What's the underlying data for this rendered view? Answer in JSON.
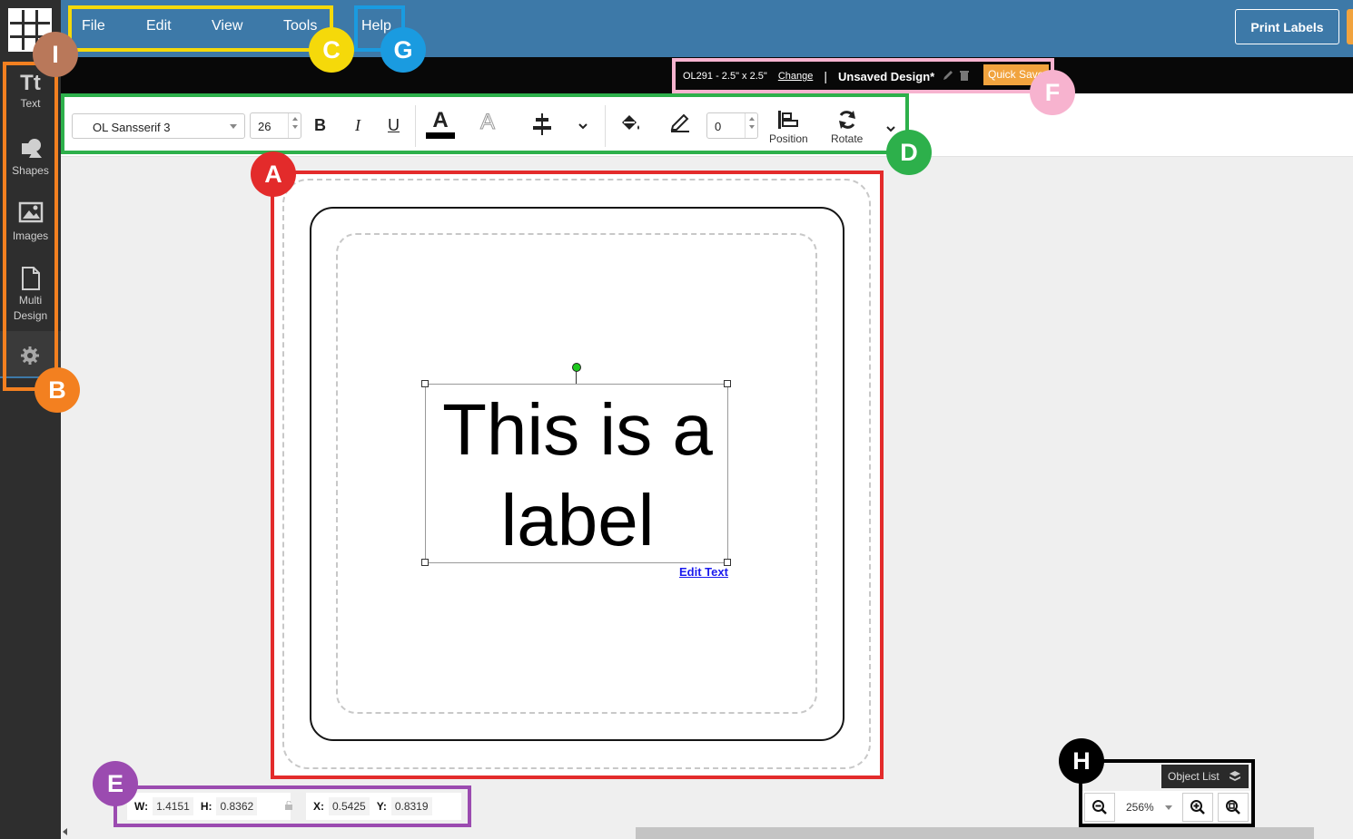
{
  "menu": {
    "file": "File",
    "edit": "Edit",
    "view": "View",
    "tools": "Tools",
    "help": "Help"
  },
  "header": {
    "print_labels": "Print Labels",
    "label_size": "OL291 - 2.5\" x 2.5\"",
    "change_link": "Change",
    "separator": "|",
    "design_name": "Unsaved Design*",
    "quick_save": "Quick Save"
  },
  "sidebar": {
    "items": [
      {
        "label": "Text",
        "icon": "text-icon"
      },
      {
        "label": "Shapes",
        "icon": "shapes-icon"
      },
      {
        "label": "Images",
        "icon": "images-icon"
      },
      {
        "label_line1": "Multi",
        "label_line2": "Design",
        "icon": "multi-design-icon"
      },
      {
        "icon": "gear-icon"
      }
    ]
  },
  "toolbar": {
    "font_family": "OL Sansserif 3",
    "font_size": "26",
    "bold": "B",
    "italic": "I",
    "underline": "U",
    "text_color_glyph": "A",
    "outline_glyph": "A",
    "border_width": "0",
    "position_label": "Position",
    "rotate_label": "Rotate"
  },
  "canvas": {
    "text_line1": "This is a",
    "text_line2": "label",
    "edit_text": "Edit Text"
  },
  "dimensions": {
    "w_label": "W:",
    "w_value": "1.4151",
    "h_label": "H:",
    "h_value": "0.8362",
    "x_label": "X:",
    "x_value": "0.5425",
    "y_label": "Y:",
    "y_value": "0.8319"
  },
  "zoom": {
    "object_list": "Object List",
    "level": "256%"
  },
  "annotations": {
    "A": "A",
    "B": "B",
    "C": "C",
    "D": "D",
    "E": "E",
    "F": "F",
    "G": "G",
    "H": "H",
    "I": "I"
  },
  "colors": {
    "topbar": "#3d79a8",
    "accent_orange": "#f1a33e",
    "annotation_red": "#e32b2b",
    "annotation_orange": "#f38020",
    "annotation_yellow": "#f5d90a",
    "annotation_green": "#2db04b",
    "annotation_purple": "#9b4bb0",
    "annotation_pink": "#f7b3cf",
    "annotation_blue": "#1a9be0",
    "annotation_black": "#000000",
    "annotation_brown": "#b9785a"
  }
}
